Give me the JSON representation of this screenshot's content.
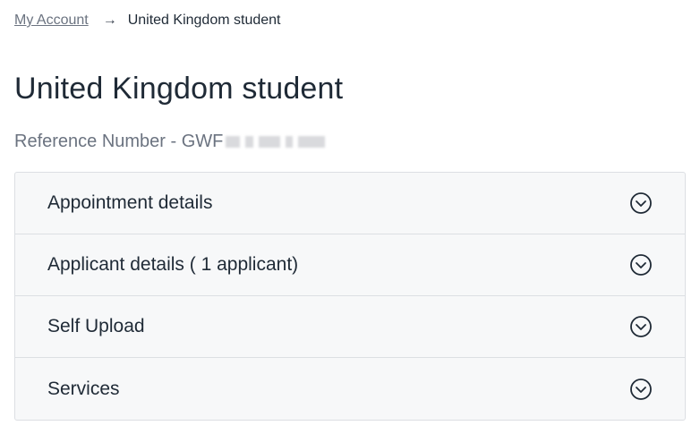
{
  "breadcrumb": {
    "home_label": "My Account",
    "separator": "→",
    "current_label": "United Kingdom student"
  },
  "page": {
    "title": "United Kingdom student",
    "reference_label": "Reference Number - GWF"
  },
  "accordion": {
    "items": [
      {
        "label": "Appointment details",
        "icon": "chevron-down-circle-icon"
      },
      {
        "label": "Applicant details ( 1 applicant)",
        "icon": "chevron-down-circle-icon"
      },
      {
        "label": "Self Upload",
        "icon": "chevron-down-circle-icon"
      },
      {
        "label": "Services",
        "icon": "chevron-down-circle-icon"
      }
    ]
  },
  "colors": {
    "text": "#1f2a36",
    "muted": "#6b7380",
    "panel_bg": "#f7f8f9",
    "border": "#dcdfe3"
  }
}
